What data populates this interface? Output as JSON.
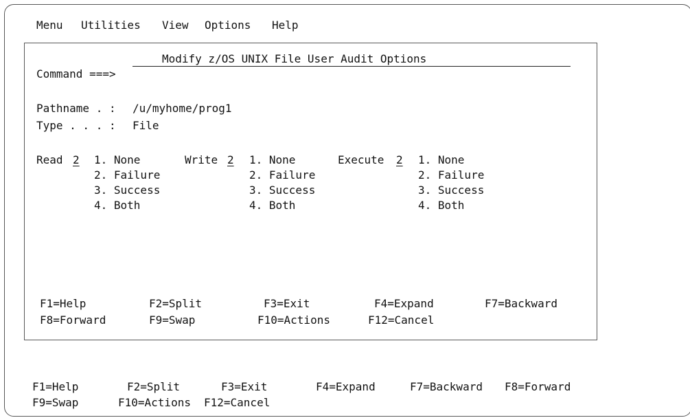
{
  "menubar": {
    "items": [
      "Menu",
      "Utilities",
      "View",
      "Options",
      "Help"
    ]
  },
  "panel": {
    "title": "Modify z/OS UNIX File User Audit Options",
    "command_label": "Command ===>",
    "command_value": "",
    "pathname_label": "Pathname . :",
    "pathname_value": "/u/myhome/prog1",
    "type_label": "Type . . . :",
    "type_value": "File",
    "read": {
      "label": "Read",
      "value": "2",
      "options": [
        "1. None",
        "2. Failure",
        "3. Success",
        "4. Both"
      ]
    },
    "write": {
      "label": "Write",
      "value": "2",
      "options": [
        "1. None",
        "2. Failure",
        "3. Success",
        "4. Both"
      ]
    },
    "execute": {
      "label": "Execute",
      "value": "2",
      "options": [
        "1. None",
        "2. Failure",
        "3. Success",
        "4. Both"
      ]
    },
    "fkeys": [
      "F1=Help",
      "F2=Split",
      "F3=Exit",
      "F4=Expand",
      "F7=Backward",
      "F8=Forward",
      "F9=Swap",
      "F10=Actions",
      "F12=Cancel"
    ]
  },
  "bottom_fkeys": [
    "F1=Help",
    "F2=Split",
    "F3=Exit",
    "F4=Expand",
    "F7=Backward",
    "F8=Forward",
    "F9=Swap",
    "F10=Actions",
    "F12=Cancel"
  ]
}
